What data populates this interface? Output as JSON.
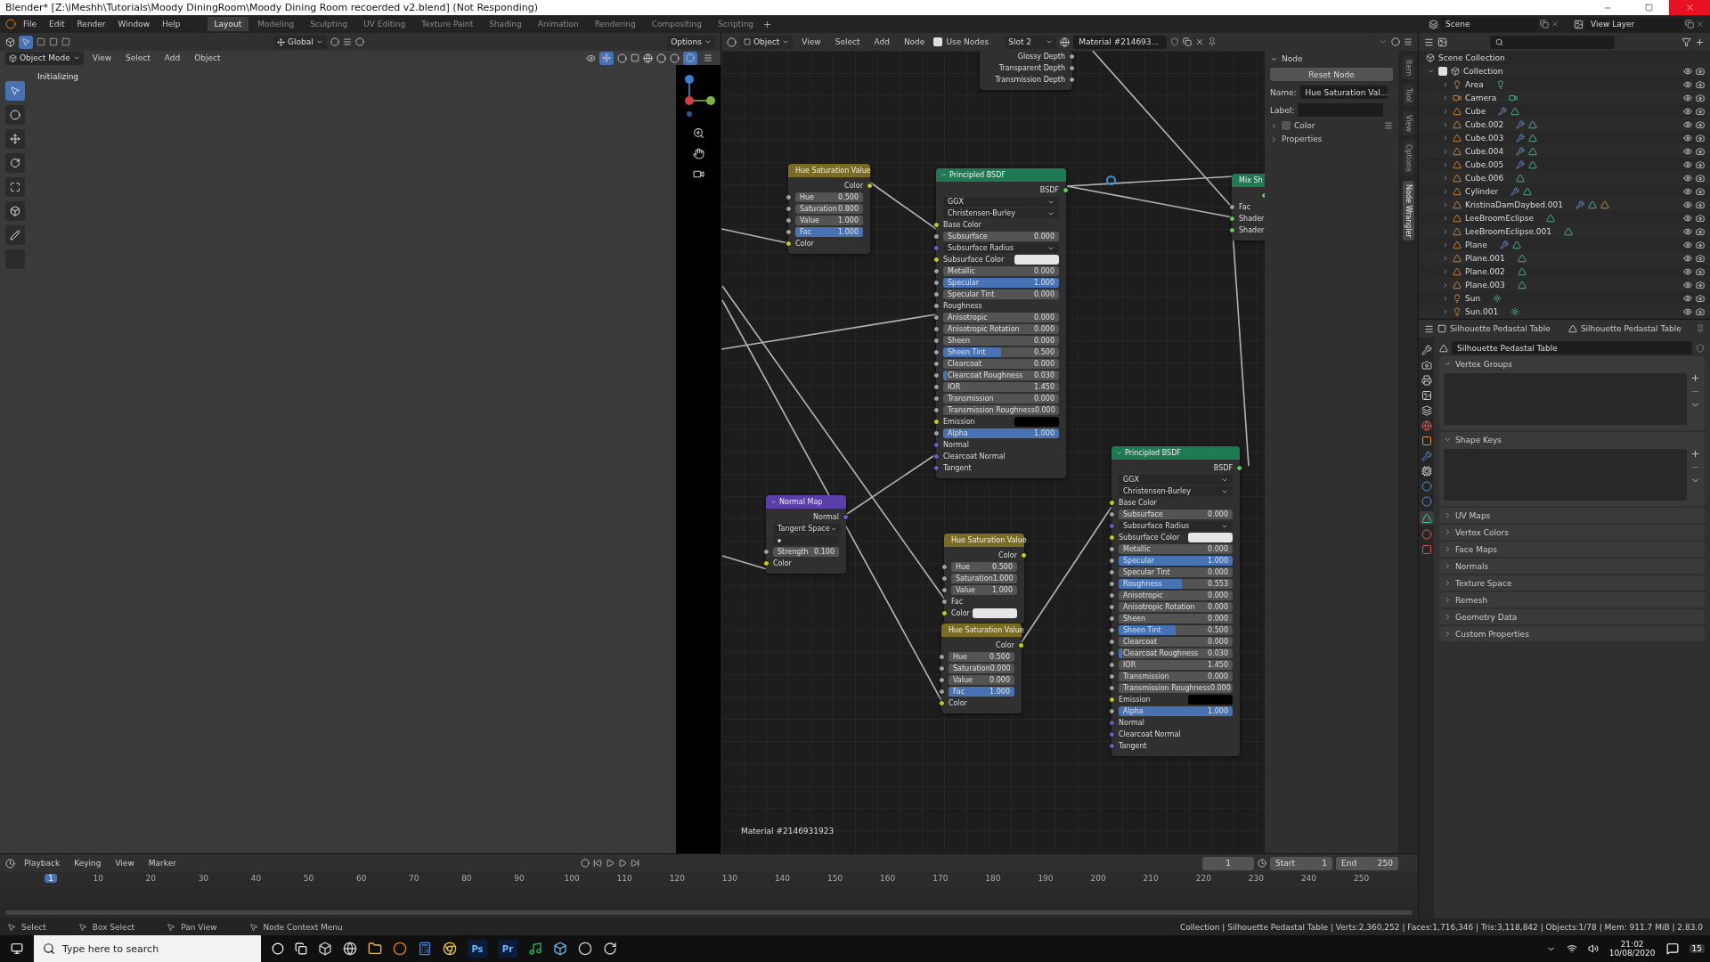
{
  "title_bar": {
    "title": "Blender* [Z:\\iMeshh\\Tutorials\\Moody DiningRoom\\Moody Dining Room recoerded v2.blend] (Not Responding)"
  },
  "menu": [
    "File",
    "Edit",
    "Render",
    "Window",
    "Help"
  ],
  "workspaces": [
    {
      "label": "Layout",
      "selected": true
    },
    {
      "label": "Modeling",
      "selected": false
    },
    {
      "label": "Sculpting",
      "selected": false
    },
    {
      "label": "UV Editing",
      "selected": false
    },
    {
      "label": "Texture Paint",
      "selected": false
    },
    {
      "label": "Shading",
      "selected": false
    },
    {
      "label": "Animation",
      "selected": false
    },
    {
      "label": "Rendering",
      "selected": false
    },
    {
      "label": "Compositing",
      "selected": false
    },
    {
      "label": "Scripting",
      "selected": false
    }
  ],
  "scene": "Scene",
  "view_layer": "View Layer",
  "viewport": {
    "orientation": "Global",
    "options": "Options",
    "mode": "Object Mode",
    "menus": [
      "View",
      "Select",
      "Add",
      "Object"
    ],
    "status_text": "Initializing"
  },
  "node_editor": {
    "object_type": "Object",
    "menus": [
      "View",
      "Select",
      "Add",
      "Node"
    ],
    "use_nodes": {
      "label": "Use Nodes",
      "checked": true
    },
    "slot": "Slot 2",
    "material": "Material #214693...",
    "footer": "Material #2146931923",
    "nodes": [
      {
        "kind": "partial",
        "rows": [
          {
            "kind": "output",
            "label": "Glossy Depth",
            "color": "#a1a1a1"
          },
          {
            "kind": "output",
            "label": "Transparent Depth",
            "color": "#a1a1a1"
          },
          {
            "kind": "output",
            "label": "Transmission Depth",
            "color": "#a1a1a1"
          }
        ]
      },
      {
        "kind": "color",
        "title": "Hue Saturation Value",
        "rows": [
          {
            "kind": "output",
            "label": "Color",
            "color": "#c7c729"
          },
          {
            "kind": "number",
            "label": "Hue",
            "value": "0.500",
            "color": "#a1a1a1"
          },
          {
            "kind": "number",
            "label": "Saturation",
            "value": "0.800",
            "color": "#a1a1a1"
          },
          {
            "kind": "number",
            "label": "Value",
            "value": "1.000",
            "color": "#a1a1a1"
          },
          {
            "kind": "slider",
            "label": "Fac",
            "value": "1.000",
            "level": 1,
            "color": "#a1a1a1"
          },
          {
            "kind": "input",
            "label": "Color",
            "color": "#c7c729"
          }
        ]
      },
      {
        "kind": "shader",
        "title": "Principled BSDF",
        "rows": [
          {
            "kind": "output",
            "label": "BSDF",
            "color": "#63c763"
          },
          {
            "kind": "select",
            "label": "GGX"
          },
          {
            "kind": "select",
            "label": "Christensen-Burley"
          },
          {
            "kind": "input",
            "label": "Base Color",
            "color": "#c7c729"
          },
          {
            "kind": "slider",
            "label": "Subsurface",
            "value": "0.000",
            "level": 0,
            "color": "#a1a1a1"
          },
          {
            "kind": "select",
            "label": "Subsurface Radius",
            "color": "#6363c7"
          },
          {
            "kind": "light_swatch",
            "label": "Subsurface Color",
            "color": "#c7c729"
          },
          {
            "kind": "slider",
            "label": "Metallic",
            "value": "0.000",
            "level": 0,
            "color": "#a1a1a1"
          },
          {
            "kind": "slider",
            "label": "Specular",
            "value": "1.000",
            "level": 1,
            "color": "#a1a1a1"
          },
          {
            "kind": "slider",
            "label": "Specular Tint",
            "value": "0.000",
            "level": 0,
            "color": "#a1a1a1"
          },
          {
            "kind": "input",
            "label": "Roughness",
            "color": "#a1a1a1"
          },
          {
            "kind": "slider",
            "label": "Anisotropic",
            "value": "0.000",
            "level": 0,
            "color": "#a1a1a1"
          },
          {
            "kind": "slider",
            "label": "Anisotropic Rotation",
            "value": "0.000",
            "level": 0,
            "color": "#a1a1a1"
          },
          {
            "kind": "slider",
            "label": "Sheen",
            "value": "0.000",
            "level": 0,
            "color": "#a1a1a1"
          },
          {
            "kind": "slider",
            "label": "Sheen Tint",
            "value": "0.500",
            "level": 0.5,
            "color": "#a1a1a1"
          },
          {
            "kind": "slider",
            "label": "Clearcoat",
            "value": "0.000",
            "level": 0,
            "color": "#a1a1a1"
          },
          {
            "kind": "slider",
            "label": "Clearcoat Roughness",
            "value": "0.030",
            "level": 0.03,
            "color": "#a1a1a1"
          },
          {
            "kind": "number",
            "label": "IOR",
            "value": "1.450",
            "color": "#a1a1a1"
          },
          {
            "kind": "slider",
            "label": "Transmission",
            "value": "0.000",
            "level": 0,
            "color": "#a1a1a1"
          },
          {
            "kind": "slider",
            "label": "Transmission Roughness",
            "value": "0.000",
            "level": 0,
            "color": "#a1a1a1"
          },
          {
            "kind": "dark_swatch",
            "label": "Emission",
            "color": "#c7c729"
          },
          {
            "kind": "slider",
            "label": "Alpha",
            "value": "1.000",
            "level": 1,
            "color": "#a1a1a1"
          },
          {
            "kind": "input",
            "label": "Normal",
            "color": "#6363c7"
          },
          {
            "kind": "input",
            "label": "Clearcoat Normal",
            "color": "#6363c7"
          },
          {
            "kind": "input",
            "label": "Tangent",
            "color": "#6363c7"
          }
        ]
      },
      {
        "kind": "shader",
        "title": "Mix Sh",
        "rows": [
          {
            "kind": "output",
            "label": "",
            "color": "#63c763"
          },
          {
            "kind": "input",
            "label": "Fac",
            "color": "#a1a1a1"
          },
          {
            "kind": "input",
            "label": "Shader",
            "color": "#63c763"
          },
          {
            "kind": "input",
            "label": "Shader",
            "color": "#63c763"
          }
        ]
      },
      {
        "kind": "shader",
        "title": "Principled BSDF",
        "rows": [
          {
            "kind": "output",
            "label": "BSDF",
            "color": "#63c763"
          },
          {
            "kind": "select",
            "label": "GGX"
          },
          {
            "kind": "select",
            "label": "Christensen-Burley"
          },
          {
            "kind": "input",
            "label": "Base Color",
            "color": "#c7c729"
          },
          {
            "kind": "slider",
            "label": "Subsurface",
            "value": "0.000",
            "level": 0,
            "color": "#a1a1a1"
          },
          {
            "kind": "select",
            "label": "Subsurface Radius",
            "color": "#6363c7"
          },
          {
            "kind": "light_swatch",
            "label": "Subsurface Color",
            "color": "#c7c729"
          },
          {
            "kind": "slider",
            "label": "Metallic",
            "value": "0.000",
            "level": 0,
            "color": "#a1a1a1"
          },
          {
            "kind": "slider",
            "label": "Specular",
            "value": "1.000",
            "level": 1,
            "color": "#a1a1a1"
          },
          {
            "kind": "slider",
            "label": "Specular Tint",
            "value": "0.000",
            "level": 0,
            "color": "#a1a1a1"
          },
          {
            "kind": "slider",
            "label": "Roughness",
            "value": "0.553",
            "level": 0.553,
            "color": "#a1a1a1"
          },
          {
            "kind": "slider",
            "label": "Anisotropic",
            "value": "0.000",
            "level": 0,
            "color": "#a1a1a1"
          },
          {
            "kind": "slider",
            "label": "Anisotropic Rotation",
            "value": "0.000",
            "level": 0,
            "color": "#a1a1a1"
          },
          {
            "kind": "slider",
            "label": "Sheen",
            "value": "0.000",
            "level": 0,
            "color": "#a1a1a1"
          },
          {
            "kind": "slider",
            "label": "Sheen Tint",
            "value": "0.500",
            "level": 0.5,
            "color": "#a1a1a1"
          },
          {
            "kind": "slider",
            "label": "Clearcoat",
            "value": "0.000",
            "level": 0,
            "color": "#a1a1a1"
          },
          {
            "kind": "slider",
            "label": "Clearcoat Roughness",
            "value": "0.030",
            "level": 0.03,
            "color": "#a1a1a1"
          },
          {
            "kind": "number",
            "label": "IOR",
            "value": "1.450",
            "color": "#a1a1a1"
          },
          {
            "kind": "slider",
            "label": "Transmission",
            "value": "0.000",
            "level": 0,
            "color": "#a1a1a1"
          },
          {
            "kind": "slider",
            "label": "Transmission Roughness",
            "value": "0.000",
            "level": 0,
            "color": "#a1a1a1"
          },
          {
            "kind": "dark_swatch",
            "label": "Emission",
            "color": "#c7c729"
          },
          {
            "kind": "slider",
            "label": "Alpha",
            "value": "1.000",
            "level": 1,
            "color": "#a1a1a1"
          },
          {
            "kind": "input",
            "label": "Normal",
            "color": "#6363c7"
          },
          {
            "kind": "input",
            "label": "Clearcoat Normal",
            "color": "#6363c7"
          },
          {
            "kind": "input",
            "label": "Tangent",
            "color": "#6363c7"
          }
        ]
      },
      {
        "kind": "vector",
        "title": "Normal Map",
        "rows": [
          {
            "kind": "output",
            "label": "Normal",
            "color": "#6363c7"
          },
          {
            "kind": "select",
            "label": "Tangent Space"
          },
          {
            "kind": "uvfield",
            "label": ""
          },
          {
            "kind": "number",
            "label": "Strength",
            "value": "0.100",
            "color": "#a1a1a1"
          },
          {
            "kind": "input",
            "label": "Color",
            "color": "#c7c729"
          }
        ]
      },
      {
        "kind": "color",
        "title": "Hue Saturation Value",
        "rows": [
          {
            "kind": "output",
            "label": "Color",
            "color": "#c7c729"
          },
          {
            "kind": "number",
            "label": "Hue",
            "value": "0.500",
            "color": "#a1a1a1"
          },
          {
            "kind": "number",
            "label": "Saturation",
            "value": "1.000",
            "color": "#a1a1a1"
          },
          {
            "kind": "number",
            "label": "Value",
            "value": "1.000",
            "color": "#a1a1a1"
          },
          {
            "kind": "input",
            "label": "Fac",
            "color": "#a1a1a1"
          },
          {
            "kind": "light_swatch",
            "label": "Color",
            "color": "#c7c729"
          }
        ]
      },
      {
        "kind": "color",
        "title": "Hue Saturation Value",
        "rows": [
          {
            "kind": "output",
            "label": "Color",
            "color": "#c7c729"
          },
          {
            "kind": "number",
            "label": "Hue",
            "value": "0.500",
            "color": "#a1a1a1"
          },
          {
            "kind": "number",
            "label": "Saturation",
            "value": "0.000",
            "color": "#a1a1a1"
          },
          {
            "kind": "number",
            "label": "Value",
            "value": "0.000",
            "color": "#a1a1a1"
          },
          {
            "kind": "slider",
            "label": "Fac",
            "value": "1.000",
            "level": 1,
            "color": "#a1a1a1"
          },
          {
            "kind": "input",
            "label": "Color",
            "color": "#c7c729"
          }
        ]
      }
    ]
  },
  "sidebar": {
    "section": "Node",
    "reset": "Reset Node",
    "name_label": "Name:",
    "name": "Hue Saturation Val...",
    "label_label": "Label:",
    "color_panel": {
      "label": "Color",
      "checked": false
    },
    "properties": "Properties",
    "tabs": [
      {
        "label": "Item",
        "selected": false
      },
      {
        "label": "Tool",
        "selected": false
      },
      {
        "label": "View",
        "selected": false
      },
      {
        "label": "Options",
        "selected": false
      },
      {
        "label": "Node Wrangler",
        "selected": true
      }
    ]
  },
  "outliner": {
    "root": "Scene Collection",
    "collection": {
      "name": "Collection",
      "checked": true
    },
    "items": [
      {
        "name": "Area",
        "kind": "area",
        "modifier": false,
        "material": false
      },
      {
        "name": "Camera",
        "kind": "camera",
        "modifier": false,
        "material": false
      },
      {
        "name": "Cube",
        "kind": "mesh",
        "modifier": true,
        "material": false
      },
      {
        "name": "Cube.002",
        "kind": "mesh",
        "modifier": true,
        "material": false
      },
      {
        "name": "Cube.003",
        "kind": "mesh",
        "modifier": true,
        "material": false
      },
      {
        "name": "Cube.004",
        "kind": "mesh",
        "modifier": true,
        "material": false
      },
      {
        "name": "Cube.005",
        "kind": "mesh",
        "modifier": true,
        "material": false
      },
      {
        "name": "Cube.006",
        "kind": "mesh",
        "modifier": false,
        "material": false
      },
      {
        "name": "Cylinder",
        "kind": "mesh",
        "modifier": true,
        "material": false
      },
      {
        "name": "KristinaDamDaybed.001",
        "kind": "mesh",
        "modifier": true,
        "material": true
      },
      {
        "name": "LeeBroomEclipse",
        "kind": "mesh",
        "modifier": false,
        "material": false
      },
      {
        "name": "LeeBroomEclipse.001",
        "kind": "mesh",
        "modifier": false,
        "material": false
      },
      {
        "name": "Plane",
        "kind": "mesh",
        "modifier": true,
        "material": false
      },
      {
        "name": "Plane.001",
        "kind": "mesh",
        "modifier": false,
        "material": false
      },
      {
        "name": "Plane.002",
        "kind": "mesh",
        "modifier": false,
        "material": false
      },
      {
        "name": "Plane.003",
        "kind": "mesh",
        "modifier": false,
        "material": false
      },
      {
        "name": "Sun",
        "kind": "sun",
        "modifier": false,
        "material": false
      },
      {
        "name": "Sun.001",
        "kind": "sun",
        "modifier": false,
        "material": false
      }
    ]
  },
  "properties": {
    "object": "Silhouette Pedastal Table",
    "mesh": "Silhouette Pedastal Table",
    "data_name": "Silhouette Pedastal Table",
    "panels": [
      {
        "label": "Vertex Groups",
        "expanded": true
      },
      {
        "label": "Shape Keys",
        "expanded": true
      },
      {
        "label": "UV Maps",
        "expanded": false
      },
      {
        "label": "Vertex Colors",
        "expanded": false
      },
      {
        "label": "Face Maps",
        "expanded": false
      },
      {
        "label": "Normals",
        "expanded": false
      },
      {
        "label": "Texture Space",
        "expanded": false
      },
      {
        "label": "Remesh",
        "expanded": false
      },
      {
        "label": "Geometry Data",
        "expanded": false
      },
      {
        "label": "Custom Properties",
        "expanded": false
      }
    ]
  },
  "timeline": {
    "menus": [
      "Playback",
      "Keying",
      "View",
      "Marker"
    ],
    "current_frame": "1",
    "start_label": "Start",
    "start": "1",
    "end_label": "End",
    "end": "250",
    "ruler": [
      {
        "label": "1",
        "selected": true
      },
      {
        "label": "10",
        "selected": false
      },
      {
        "label": "20",
        "selected": false
      },
      {
        "label": "30",
        "selected": false
      },
      {
        "label": "40",
        "selected": false
      },
      {
        "label": "50",
        "selected": false
      },
      {
        "label": "60",
        "selected": false
      },
      {
        "label": "70",
        "selected": false
      },
      {
        "label": "80",
        "selected": false
      },
      {
        "label": "90",
        "selected": false
      },
      {
        "label": "100",
        "selected": false
      },
      {
        "label": "110",
        "selected": false
      },
      {
        "label": "120",
        "selected": false
      },
      {
        "label": "130",
        "selected": false
      },
      {
        "label": "140",
        "selected": false
      },
      {
        "label": "150",
        "selected": false
      },
      {
        "label": "160",
        "selected": false
      },
      {
        "label": "170",
        "selected": false
      },
      {
        "label": "180",
        "selected": false
      },
      {
        "label": "190",
        "selected": false
      },
      {
        "label": "200",
        "selected": false
      },
      {
        "label": "210",
        "selected": false
      },
      {
        "label": "220",
        "selected": false
      },
      {
        "label": "230",
        "selected": false
      },
      {
        "label": "240",
        "selected": false
      },
      {
        "label": "250",
        "selected": false
      }
    ]
  },
  "status_bar": {
    "hints": [
      "Select",
      "Box Select",
      "Pan View",
      "Node Context Menu"
    ],
    "stats": "Collection | Silhouette Pedastal Table | Verts:2,360,252 | Faces:1,716,346 | Tris:3,118,842 | Objects:1/78 | Mem: 911.7 MiB | 2.83.0"
  },
  "taskbar": {
    "search_placeholder": "Type here to search",
    "apps": [
      "Ps",
      "Pr"
    ],
    "time": "21:02",
    "date": "10/08/2020",
    "notifications": "15"
  }
}
